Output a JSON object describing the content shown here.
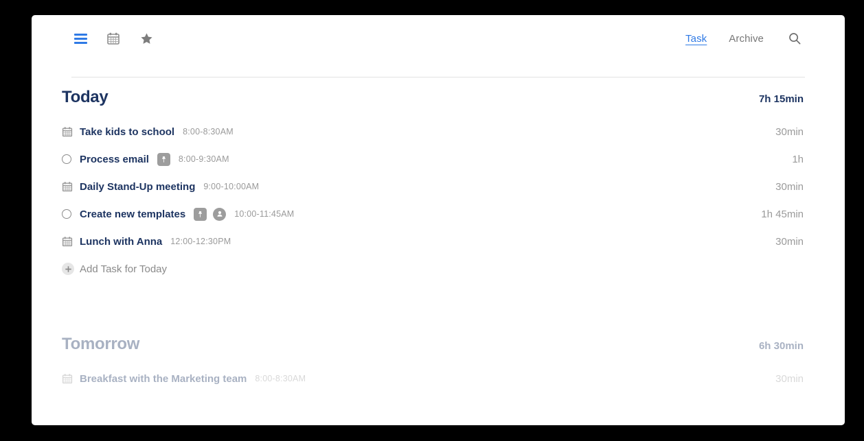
{
  "toolbar": {
    "icons": [
      {
        "name": "menu-icon",
        "label": "Menu"
      },
      {
        "name": "calendar-icon",
        "label": "Calendar"
      },
      {
        "name": "star-icon",
        "label": "Favorites"
      }
    ]
  },
  "nav": {
    "tabs": [
      {
        "label": "Task",
        "active": true
      },
      {
        "label": "Archive",
        "active": false
      }
    ],
    "search_icon": "search-icon"
  },
  "colors": {
    "accent_blue": "#2f7ae5",
    "navy": "#1d3461",
    "muted_gray": "#9a9a9a",
    "badge_gray": "#9d9d9d",
    "divider": "#e2e2e2",
    "page_background": "#000000",
    "card_background": "#ffffff"
  },
  "sections": [
    {
      "title": "Today",
      "total": "7h 15min",
      "faded": false,
      "add_task_label": "Add Task for Today",
      "tasks": [
        {
          "lead": "calendar",
          "title": "Take kids to school",
          "time": "8:00-8:30AM",
          "duration": "30min",
          "badges": []
        },
        {
          "lead": "checkbox",
          "title": "Process email",
          "time": "8:00-9:30AM",
          "duration": "1h",
          "badges": [
            "pin"
          ]
        },
        {
          "lead": "calendar",
          "title": "Daily Stand-Up meeting",
          "time": "9:00-10:00AM",
          "duration": "30min",
          "badges": []
        },
        {
          "lead": "checkbox",
          "title": "Create new templates",
          "time": "10:00-11:45AM",
          "duration": "1h 45min",
          "badges": [
            "pin",
            "person"
          ]
        },
        {
          "lead": "calendar",
          "title": "Lunch with Anna",
          "time": "12:00-12:30PM",
          "duration": "30min",
          "badges": []
        }
      ]
    },
    {
      "title": "Tomorrow",
      "total": "6h 30min",
      "faded": true,
      "add_task_label": null,
      "tasks": [
        {
          "lead": "calendar",
          "title": "Breakfast with the Marketing team",
          "time": "8:00-8:30AM",
          "duration": "30min",
          "badges": []
        }
      ]
    }
  ]
}
